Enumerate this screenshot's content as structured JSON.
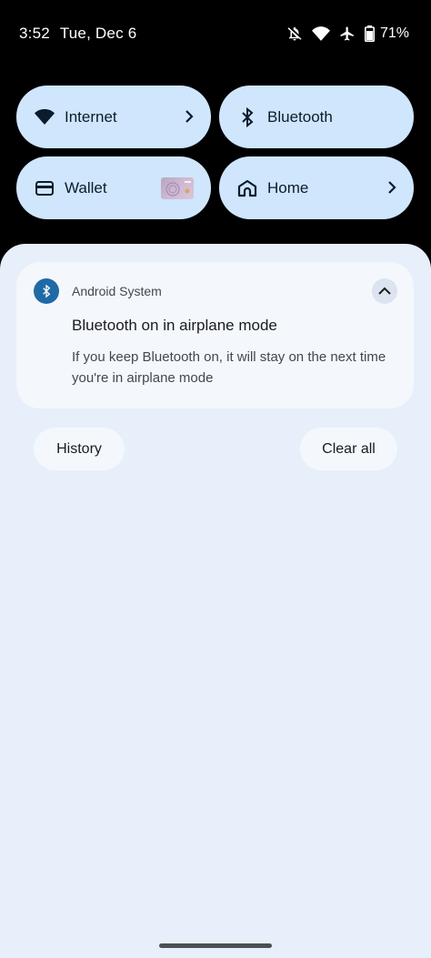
{
  "status_bar": {
    "time": "3:52",
    "date": "Tue, Dec 6",
    "battery_percent": "71%",
    "icons": [
      "notifications-off-icon",
      "wifi-icon",
      "airplane-icon",
      "battery-icon"
    ]
  },
  "quick_tiles": [
    {
      "label": "Internet",
      "icon": "wifi-icon",
      "has_chevron": true
    },
    {
      "label": "Bluetooth",
      "icon": "bluetooth-icon",
      "has_chevron": false
    },
    {
      "label": "Wallet",
      "icon": "wallet-icon",
      "has_card_thumbnail": true
    },
    {
      "label": "Home",
      "icon": "home-icon",
      "has_chevron": true
    }
  ],
  "notification": {
    "app_name": "Android System",
    "app_icon": "bluetooth-icon",
    "title": "Bluetooth on in airplane mode",
    "body": "If you keep Bluetooth on, it will stay on the next time you're in airplane mode"
  },
  "actions": {
    "history_label": "History",
    "clear_all_label": "Clear all"
  },
  "colors": {
    "tile_bg": "#cfe6fd",
    "shade_bg": "#e6effa",
    "card_bg": "#f4f7fc",
    "app_icon_bg": "#1f6aa5"
  }
}
